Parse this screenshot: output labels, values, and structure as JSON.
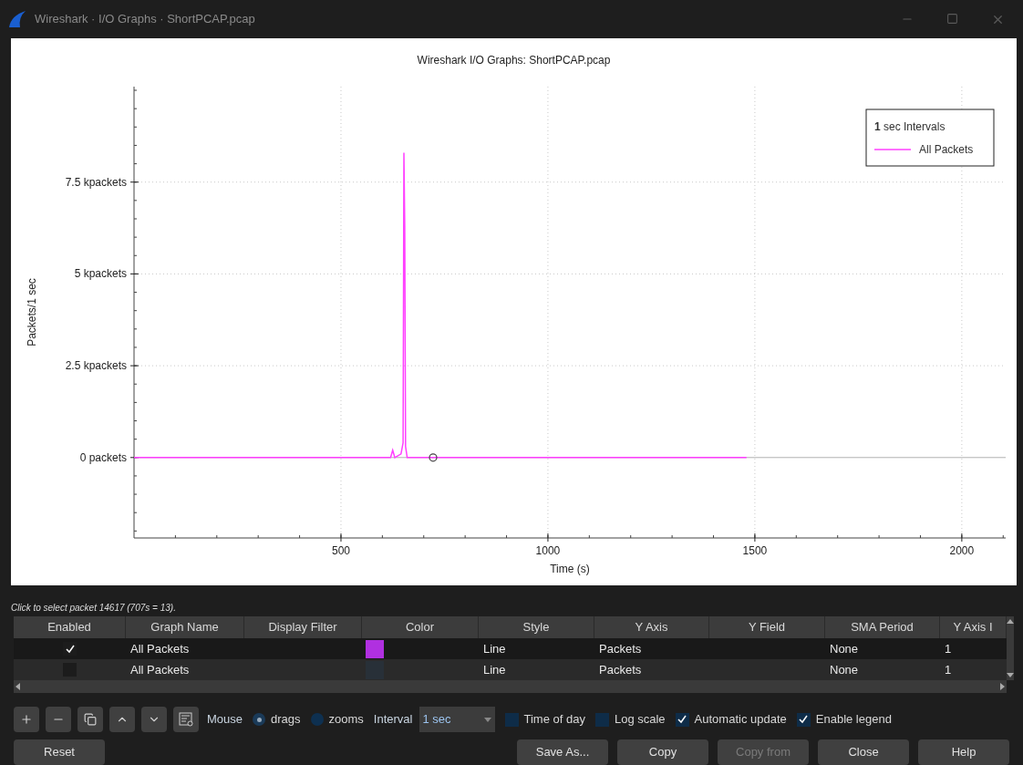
{
  "window": {
    "title": "Wireshark · I/O Graphs · ShortPCAP.pcap"
  },
  "graph": {
    "title": "Wireshark I/O Graphs: ShortPCAP.pcap",
    "legend": {
      "interval": "**1** sec Intervals"
    },
    "chart_data": {
      "type": "line",
      "grid": true,
      "xlabel": "Time (s)",
      "ylabel": "Packets/1 sec",
      "xlim": [
        0,
        2106
      ],
      "ylim": [
        -2.19,
        10.1
      ],
      "xticks": [
        500,
        1000,
        1500,
        2000
      ],
      "yticks": [
        {
          "value": 0,
          "label": "0 packets"
        },
        {
          "value": 2.5,
          "label": "2.5 kpackets"
        },
        {
          "value": 5,
          "label": "5 kpackets"
        },
        {
          "value": 7.5,
          "label": "7.5 kpackets"
        }
      ],
      "x": [
        0,
        200,
        400,
        620,
        625,
        630,
        645,
        650,
        652,
        654,
        656,
        660,
        700,
        1000,
        1300,
        1480
      ],
      "series": [
        {
          "name": "All Packets",
          "color": "#ff40ff",
          "values": [
            0,
            0,
            0,
            0,
            0.2,
            0,
            0.1,
            0.4,
            8.3,
            6.3,
            0.3,
            0,
            0,
            0,
            0,
            0
          ]
        }
      ]
    }
  },
  "status": "Click to select packet 14617 (707s = 13).",
  "table": {
    "columns": [
      "Enabled",
      "Graph Name",
      "Display Filter",
      "Color",
      "Style",
      "Y Axis",
      "Y Field",
      "SMA Period",
      "Y Axis I"
    ],
    "rows": [
      {
        "checked": true,
        "name": "All Packets",
        "color": "#b030e0",
        "style": "Line",
        "y_axis": "Packets",
        "sma": "None",
        "factor": "1"
      },
      {
        "checked": false,
        "name": "All Packets",
        "color": "#283038",
        "style": "Line",
        "y_axis": "Packets",
        "sma": "None",
        "factor": "1"
      }
    ]
  },
  "toolbar": {
    "mouse_label": "Mouse",
    "modes": [
      {
        "label": "drags",
        "selected": true
      },
      {
        "label": "zooms",
        "selected": false
      }
    ],
    "interval_label": "Interval",
    "interval": "1 sec",
    "options": [
      {
        "label": "Time of day",
        "checked": false
      },
      {
        "label": "Log scale",
        "checked": false
      },
      {
        "label": "Automatic update",
        "checked": true
      },
      {
        "label": "Enable legend",
        "checked": true
      }
    ]
  },
  "buttons": [
    {
      "label": "Reset",
      "disabled": false
    },
    {
      "label": "Save As...",
      "disabled": false
    },
    {
      "label": "Copy",
      "disabled": false
    },
    {
      "label": "Copy from",
      "disabled": true
    },
    {
      "label": "Close",
      "disabled": false
    },
    {
      "label": "Help",
      "disabled": false
    }
  ]
}
